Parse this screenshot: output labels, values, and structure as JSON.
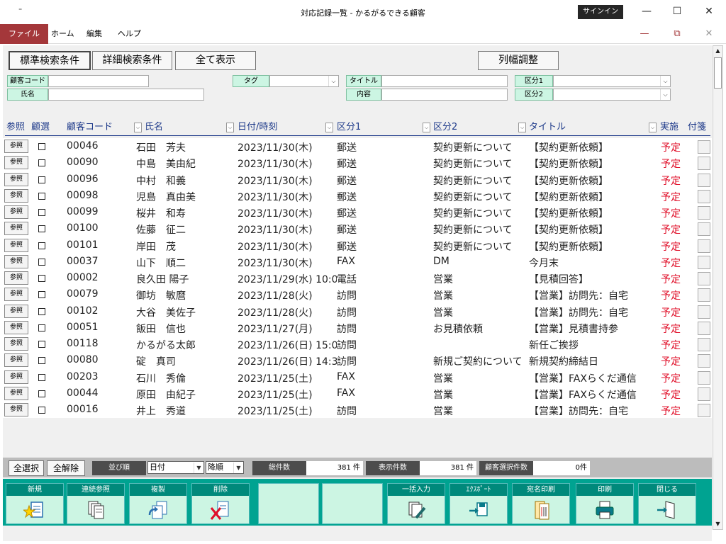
{
  "window": {
    "quick_access": "⁼",
    "title": "対応記録一覧 - かるがるできる顧客",
    "signin": "サインイン",
    "minimize": "—",
    "maximize": "☐",
    "close": "✕"
  },
  "menu": {
    "items": [
      "ファイル",
      "ホーム",
      "編集",
      "ヘルプ"
    ],
    "doc_min": "—",
    "doc_restore": "⧉",
    "doc_close": "✕"
  },
  "toolbar": {
    "standard_search": "標準検索条件",
    "detailed_search": "詳細検索条件",
    "show_all": "全て表示",
    "column_adjust": "列幅調整"
  },
  "filters": {
    "customer_code_label": "顧客コード",
    "name_label": "氏名",
    "tag_label": "タグ",
    "title_label": "タイトル",
    "content_label": "内容",
    "cat1_label": "区分1",
    "cat2_label": "区分2",
    "arrow": "⌵"
  },
  "columns": {
    "ref": "参照",
    "select": "顧選",
    "code": "顧客コード",
    "name": "氏名",
    "datetime": "日付/時刻",
    "cat1": "区分1",
    "cat2": "区分2",
    "title": "タイトル",
    "status": "実施",
    "memo": "付箋",
    "sort_arrow": "⌵"
  },
  "ref_label": "参照",
  "rows": [
    {
      "code": "00046",
      "name": "石田　芳夫",
      "date": "2023/11/30(木)",
      "cat1": "郵送",
      "cat2": "契約更新について",
      "title": "【契約更新依頼】",
      "status": "予定"
    },
    {
      "code": "00090",
      "name": "中島　美由紀",
      "date": "2023/11/30(木)",
      "cat1": "郵送",
      "cat2": "契約更新について",
      "title": "【契約更新依頼】",
      "status": "予定"
    },
    {
      "code": "00096",
      "name": "中村　和義",
      "date": "2023/11/30(木)",
      "cat1": "郵送",
      "cat2": "契約更新について",
      "title": "【契約更新依頼】",
      "status": "予定"
    },
    {
      "code": "00098",
      "name": "児島　真由美",
      "date": "2023/11/30(木)",
      "cat1": "郵送",
      "cat2": "契約更新について",
      "title": "【契約更新依頼】",
      "status": "予定"
    },
    {
      "code": "00099",
      "name": "桜井　和寿",
      "date": "2023/11/30(木)",
      "cat1": "郵送",
      "cat2": "契約更新について",
      "title": "【契約更新依頼】",
      "status": "予定"
    },
    {
      "code": "00100",
      "name": "佐藤　征二",
      "date": "2023/11/30(木)",
      "cat1": "郵送",
      "cat2": "契約更新について",
      "title": "【契約更新依頼】",
      "status": "予定"
    },
    {
      "code": "00101",
      "name": "岸田　茂",
      "date": "2023/11/30(木)",
      "cat1": "郵送",
      "cat2": "契約更新について",
      "title": "【契約更新依頼】",
      "status": "予定"
    },
    {
      "code": "00037",
      "name": "山下　順二",
      "date": "2023/11/30(木)",
      "cat1": "FAX",
      "cat2": "DM",
      "title": "今月末",
      "status": "予定"
    },
    {
      "code": "00002",
      "name": "良久田 陽子",
      "date": "2023/11/29(水) 10:0",
      "cat1": "電話",
      "cat2": "営業",
      "title": "【見積回答】",
      "status": "予定"
    },
    {
      "code": "00079",
      "name": "御坊　敏麿",
      "date": "2023/11/28(火)",
      "cat1": "訪問",
      "cat2": "営業",
      "title": "【営業】訪問先：自宅",
      "status": "予定"
    },
    {
      "code": "00102",
      "name": "大谷　美佐子",
      "date": "2023/11/28(火)",
      "cat1": "訪問",
      "cat2": "営業",
      "title": "【営業】訪問先：自宅",
      "status": "予定"
    },
    {
      "code": "00051",
      "name": "飯田　信也",
      "date": "2023/11/27(月)",
      "cat1": "訪問",
      "cat2": "お見積依頼",
      "title": "【営業】見積書持参",
      "status": "予定"
    },
    {
      "code": "00118",
      "name": "かるがる太郎",
      "date": "2023/11/26(日) 15:0",
      "cat1": "訪問",
      "cat2": "",
      "title": "新任ご挨拶",
      "status": "予定"
    },
    {
      "code": "00080",
      "name": "碇　真司",
      "date": "2023/11/26(日) 14:3",
      "cat1": "訪問",
      "cat2": "新規ご契約について",
      "title": "新規契約締結日",
      "status": "予定"
    },
    {
      "code": "00203",
      "name": "石川　秀倫",
      "date": "2023/11/25(土)",
      "cat1": "FAX",
      "cat2": "営業",
      "title": "【営業】FAXらくだ通信",
      "status": "予定"
    },
    {
      "code": "00044",
      "name": "原田　由紀子",
      "date": "2023/11/25(土)",
      "cat1": "FAX",
      "cat2": "営業",
      "title": "【営業】FAXらくだ通信",
      "status": "予定"
    },
    {
      "code": "00016",
      "name": "井上　秀道",
      "date": "2023/11/25(土)",
      "cat1": "訪問",
      "cat2": "営業",
      "title": "【営業】訪問先：自宅",
      "status": "予定"
    }
  ],
  "footer": {
    "select_all": "全選択",
    "deselect_all": "全解除",
    "sort_label": "並び順",
    "sort_field": "日付",
    "sort_dir": "降順",
    "total_label": "総件数",
    "total_value": "381 件",
    "shown_label": "表示件数",
    "shown_value": "381 件",
    "selected_label": "顧客選択件数",
    "selected_value": "0件"
  },
  "actions": {
    "new": "新規",
    "continuous_ref": "連続参照",
    "copy": "複製",
    "delete": "削除",
    "bulk_input": "一括入力",
    "export": "ｴｸｽﾎﾟｰﾄ",
    "address_print": "宛名印刷",
    "print": "印刷",
    "close": "閉じる"
  },
  "colors": {
    "accent_red": "#a4373a",
    "teal": "#00a391",
    "mint": "#ccf5e3",
    "status_red": "#e0102a",
    "header_blue": "#1e3a8a"
  }
}
